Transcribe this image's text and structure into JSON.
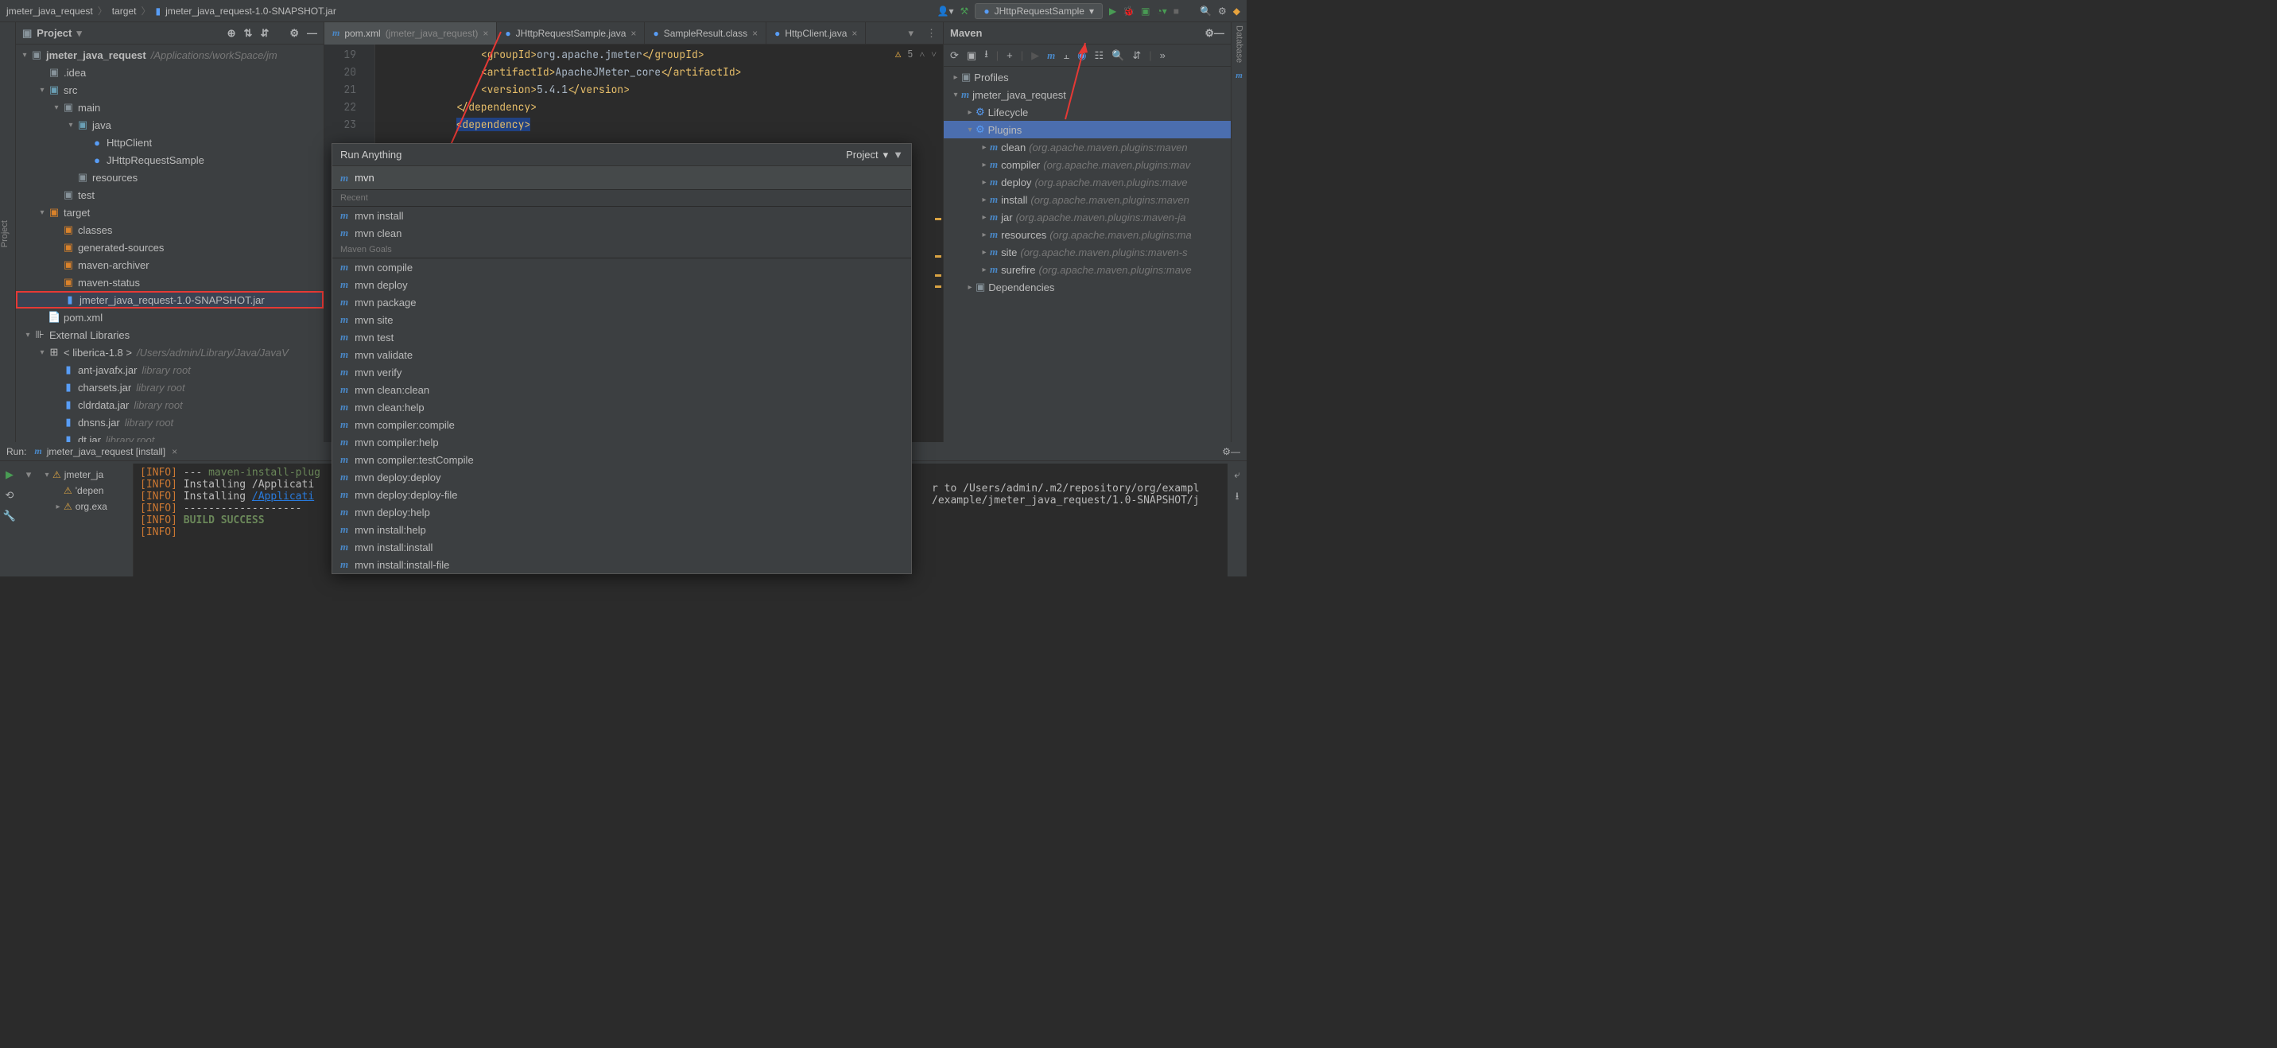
{
  "breadcrumb": [
    "jmeter_java_request",
    "target",
    "jmeter_java_request-1.0-SNAPSHOT.jar"
  ],
  "run_config": "JHttpRequestSample",
  "project": {
    "title": "Project",
    "root": {
      "name": "jmeter_java_request",
      "path": "/Applications/workSpace/jm"
    },
    "rows": [
      {
        "indent": 1,
        "chev": "",
        "icon": "folder",
        "name": ".idea"
      },
      {
        "indent": 1,
        "chev": "v",
        "icon": "folder-blue",
        "name": "src"
      },
      {
        "indent": 2,
        "chev": "v",
        "icon": "folder",
        "name": "main"
      },
      {
        "indent": 3,
        "chev": "v",
        "icon": "folder-blue",
        "name": "java"
      },
      {
        "indent": 4,
        "chev": "",
        "icon": "class",
        "name": "HttpClient"
      },
      {
        "indent": 4,
        "chev": "",
        "icon": "class",
        "name": "JHttpRequestSample"
      },
      {
        "indent": 3,
        "chev": "",
        "icon": "folder",
        "name": "resources"
      },
      {
        "indent": 2,
        "chev": "",
        "icon": "folder",
        "name": "test"
      },
      {
        "indent": 1,
        "chev": "v",
        "icon": "folder-orange",
        "name": "target"
      },
      {
        "indent": 2,
        "chev": "",
        "icon": "folder-orange",
        "name": "classes"
      },
      {
        "indent": 2,
        "chev": "",
        "icon": "folder-orange",
        "name": "generated-sources"
      },
      {
        "indent": 2,
        "chev": "",
        "icon": "folder-orange",
        "name": "maven-archiver"
      },
      {
        "indent": 2,
        "chev": "",
        "icon": "folder-orange",
        "name": "maven-status"
      },
      {
        "indent": 2,
        "chev": "",
        "icon": "jar",
        "name": "jmeter_java_request-1.0-SNAPSHOT.jar",
        "highlight": true
      },
      {
        "indent": 1,
        "chev": "",
        "icon": "file",
        "name": "pom.xml"
      },
      {
        "indent": 0,
        "chev": "v",
        "icon": "lib",
        "name": "External Libraries"
      },
      {
        "indent": 1,
        "chev": "v",
        "icon": "sdk",
        "name": "< liberica-1.8 >",
        "dim": "/Users/admin/Library/Java/JavaV"
      },
      {
        "indent": 2,
        "chev": "",
        "icon": "jar",
        "name": "ant-javafx.jar",
        "dim": "library root"
      },
      {
        "indent": 2,
        "chev": "",
        "icon": "jar",
        "name": "charsets.jar",
        "dim": "library root"
      },
      {
        "indent": 2,
        "chev": "",
        "icon": "jar",
        "name": "cldrdata.jar",
        "dim": "library root"
      },
      {
        "indent": 2,
        "chev": "",
        "icon": "jar",
        "name": "dnsns.jar",
        "dim": "library root"
      },
      {
        "indent": 2,
        "chev": "",
        "icon": "jar",
        "name": "dt.jar",
        "dim": "library root"
      }
    ]
  },
  "tabs": [
    {
      "icon": "m",
      "label": "pom.xml",
      "suffix": "(jmeter_java_request)",
      "active": true
    },
    {
      "icon": "c",
      "label": "JHttpRequestSample.java"
    },
    {
      "icon": "c",
      "label": "SampleResult.class"
    },
    {
      "icon": "c",
      "label": "HttpClient.java"
    }
  ],
  "code": {
    "start": 19,
    "lines": [
      {
        "n": 19,
        "indent": 4,
        "raw": "<groupId>org.apache.jmeter</groupId>"
      },
      {
        "n": 20,
        "indent": 4,
        "raw": "<artifactId>ApacheJMeter_core</artifactId>"
      },
      {
        "n": 21,
        "indent": 4,
        "raw": "<version>5.4.1</version>"
      },
      {
        "n": 22,
        "indent": 3,
        "raw": "</dependency>"
      },
      {
        "n": 23,
        "indent": 3,
        "raw": "<dependency>",
        "hl": true
      }
    ],
    "inspection": "5"
  },
  "maven": {
    "title": "Maven",
    "rows": [
      {
        "indent": 0,
        "chev": ">",
        "icon": "folder",
        "name": "Profiles"
      },
      {
        "indent": 0,
        "chev": "v",
        "icon": "m",
        "name": "jmeter_java_request"
      },
      {
        "indent": 1,
        "chev": ">",
        "icon": "gear",
        "name": "Lifecycle"
      },
      {
        "indent": 1,
        "chev": "v",
        "icon": "gear",
        "name": "Plugins",
        "selected": true
      },
      {
        "indent": 2,
        "chev": ">",
        "icon": "m",
        "name": "clean",
        "dim": "(org.apache.maven.plugins:maven"
      },
      {
        "indent": 2,
        "chev": ">",
        "icon": "m",
        "name": "compiler",
        "dim": "(org.apache.maven.plugins:mav"
      },
      {
        "indent": 2,
        "chev": ">",
        "icon": "m",
        "name": "deploy",
        "dim": "(org.apache.maven.plugins:mave"
      },
      {
        "indent": 2,
        "chev": ">",
        "icon": "m",
        "name": "install",
        "dim": "(org.apache.maven.plugins:maven"
      },
      {
        "indent": 2,
        "chev": ">",
        "icon": "m",
        "name": "jar",
        "dim": "(org.apache.maven.plugins:maven-ja"
      },
      {
        "indent": 2,
        "chev": ">",
        "icon": "m",
        "name": "resources",
        "dim": "(org.apache.maven.plugins:ma"
      },
      {
        "indent": 2,
        "chev": ">",
        "icon": "m",
        "name": "site",
        "dim": "(org.apache.maven.plugins:maven-s"
      },
      {
        "indent": 2,
        "chev": ">",
        "icon": "m",
        "name": "surefire",
        "dim": "(org.apache.maven.plugins:mave"
      },
      {
        "indent": 1,
        "chev": ">",
        "icon": "folder",
        "name": "Dependencies"
      }
    ]
  },
  "run_anything": {
    "title": "Run Anything",
    "scope": "Project",
    "input": "mvn",
    "recent_label": "Recent",
    "recent": [
      "mvn install",
      "mvn clean"
    ],
    "goals_label": "Maven Goals",
    "goals": [
      "mvn compile",
      "mvn deploy",
      "mvn package",
      "mvn site",
      "mvn test",
      "mvn validate",
      "mvn verify",
      "mvn clean:clean",
      "mvn clean:help",
      "mvn compiler:compile",
      "mvn compiler:help",
      "mvn compiler:testCompile",
      "mvn deploy:deploy",
      "mvn deploy:deploy-file",
      "mvn deploy:help",
      "mvn install:help",
      "mvn install:install",
      "mvn install:install-file"
    ]
  },
  "run": {
    "label": "Run:",
    "config": "jmeter_java_request [install]",
    "tree": [
      {
        "chev": "v",
        "warn": true,
        "name": "jmeter_ja"
      },
      {
        "chev": "",
        "warn": true,
        "name": "'depen",
        "indent": 1
      },
      {
        "chev": ">",
        "warn": true,
        "name": "org.exa",
        "indent": 1
      }
    ],
    "console": [
      {
        "p": "[INFO]",
        "t": " --- ",
        "g": "maven-install-plug"
      },
      {
        "p": "[INFO]",
        "t": " Installing /Applicati"
      },
      {
        "p": "[INFO]",
        "t": " Installing ",
        "link": "/Applicati"
      },
      {
        "p": "[INFO]",
        "t": " -------------------"
      },
      {
        "p": "[INFO]",
        "s": " BUILD SUCCESS"
      },
      {
        "p": "[INFO]",
        "t": ""
      }
    ],
    "console_right": [
      "r to /Users/admin/.m2/repository/org/exampl",
      "/example/jmeter_java_request/1.0-SNAPSHOT/j"
    ]
  }
}
